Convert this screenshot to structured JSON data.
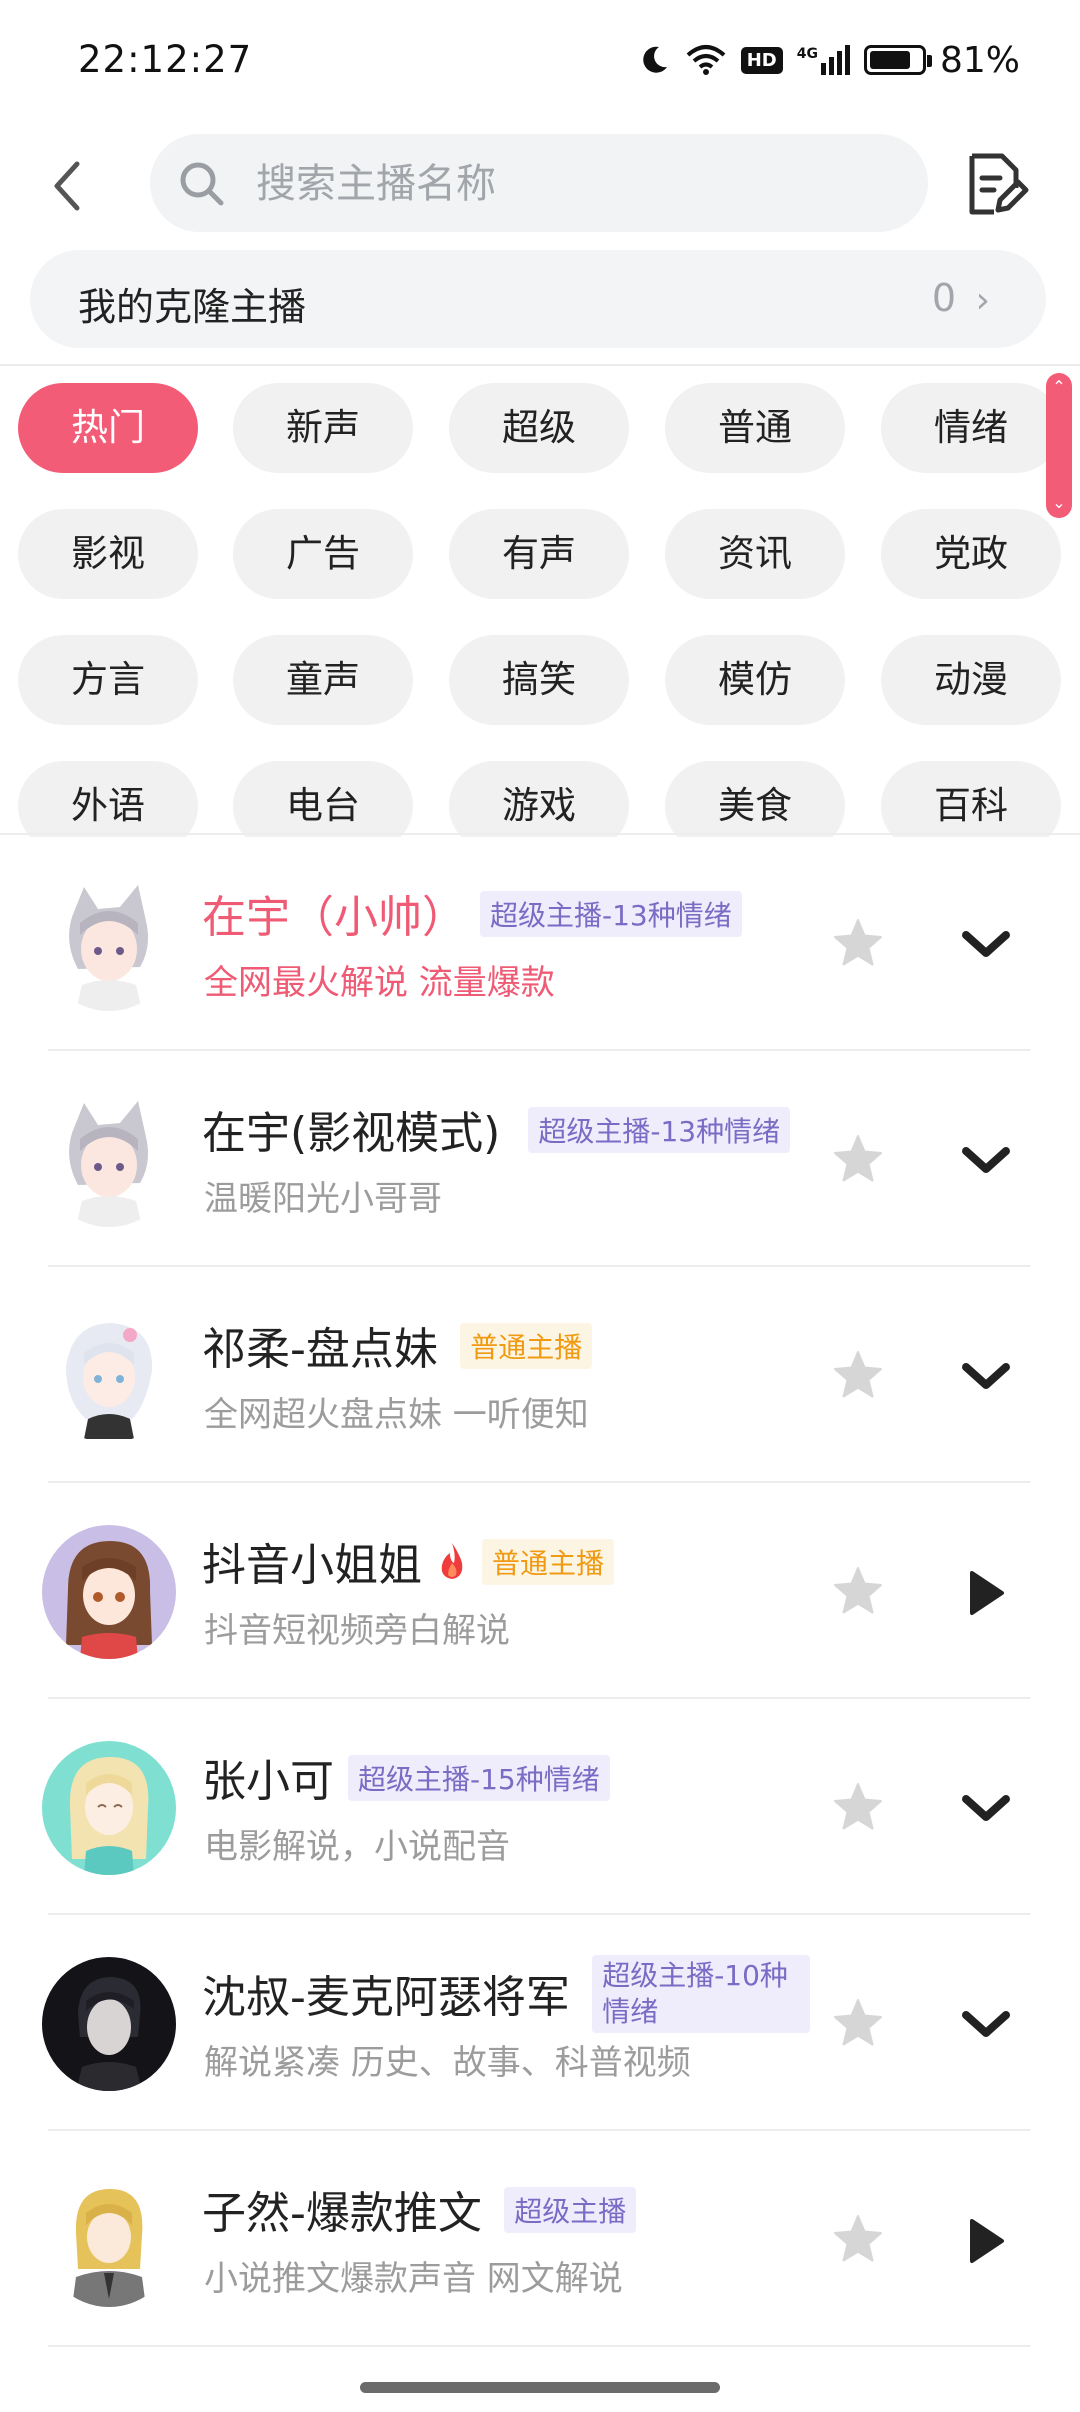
{
  "status_bar": {
    "time": "22:12:27",
    "battery": "81%",
    "battery_level": 0.81,
    "hd": "HD",
    "network": "4G"
  },
  "search": {
    "placeholder": "搜索主播名称"
  },
  "clone": {
    "label": "我的克隆主播",
    "count": "0"
  },
  "categories": [
    "热门",
    "新声",
    "超级",
    "普通",
    "情绪",
    "影视",
    "广告",
    "有声",
    "资讯",
    "党政",
    "方言",
    "童声",
    "搞笑",
    "模仿",
    "动漫",
    "外语",
    "电台",
    "游戏",
    "美食",
    "百科"
  ],
  "active_category": "热门",
  "anchors": [
    {
      "name": "在宇（小帅）",
      "tag": "超级主播-13种情绪",
      "tag_type": "super",
      "desc": "全网最火解说 流量爆款",
      "highlight": true,
      "action": "expand",
      "avatar": "silver-hair-boy-avatar"
    },
    {
      "name": "在宇(影视模式)",
      "tag": "超级主播-13种情绪",
      "tag_type": "super",
      "desc": "温暖阳光小哥哥",
      "highlight": false,
      "action": "expand",
      "avatar": "silver-hair-boy-avatar"
    },
    {
      "name": "祁柔-盘点妹",
      "tag": "普通主播",
      "tag_type": "normal",
      "desc": "全网超火盘点妹 一听便知",
      "highlight": false,
      "action": "expand",
      "avatar": "white-hair-girl-avatar"
    },
    {
      "name": "抖音小姐姐",
      "tag": "普通主播",
      "tag_type": "normal",
      "desc": "抖音短视频旁白解说",
      "highlight": false,
      "action": "play",
      "hot_icon": true,
      "avatar": "brown-hair-girl-avatar"
    },
    {
      "name": "张小可",
      "tag": "超级主播-15种情绪",
      "tag_type": "super",
      "desc": "电影解说，小说配音",
      "highlight": false,
      "action": "expand",
      "avatar": "blonde-girl-avatar"
    },
    {
      "name": "沈叔-麦克阿瑟将军",
      "tag": "超级主播-10种情绪",
      "tag_type": "super",
      "desc": "解说紧凑 历史、故事、科普视频",
      "highlight": false,
      "action": "expand",
      "avatar": "dark-man-avatar"
    },
    {
      "name": "子然-爆款推文",
      "tag": "超级主播",
      "tag_type": "super",
      "desc": "小说推文爆款声音 网文解说",
      "highlight": false,
      "action": "play",
      "avatar": "blonde-suit-avatar"
    }
  ],
  "colors": {
    "accent": "#f25c77",
    "super_tag": "#7a6bc4",
    "normal_tag": "#ef9a12"
  }
}
